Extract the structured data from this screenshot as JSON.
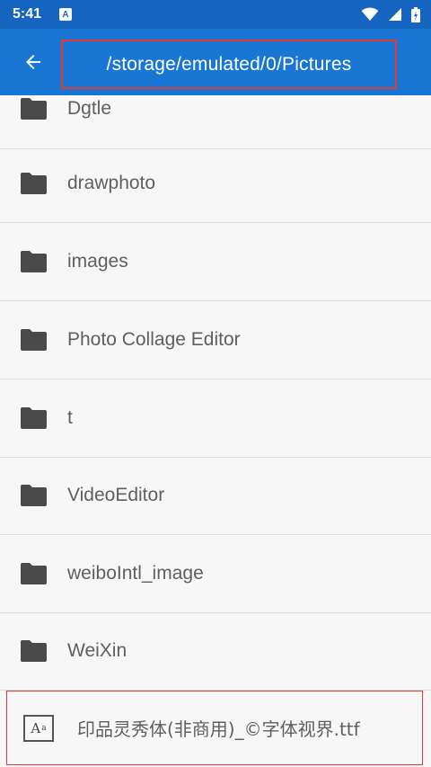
{
  "status_bar": {
    "time": "5:41",
    "notification_letter": "A",
    "icons": [
      "wifi-icon",
      "signal-icon",
      "battery-icon"
    ]
  },
  "app_bar": {
    "back_icon": "arrow-left-icon",
    "path": "/storage/emulated/0/Pictures"
  },
  "folders": [
    {
      "name": "Dgtle"
    },
    {
      "name": "drawphoto"
    },
    {
      "name": "images"
    },
    {
      "name": "Photo Collage Editor"
    },
    {
      "name": "t"
    },
    {
      "name": "VideoEditor"
    },
    {
      "name": "weiboIntl_image"
    },
    {
      "name": "WeiXin"
    }
  ],
  "file": {
    "name": "印品灵秀体(非商用)_©字体视界.ttf",
    "icon_text": "A",
    "icon_sup": "a"
  },
  "colors": {
    "status_bar": "#1565c0",
    "app_bar": "#1976d2",
    "highlight": "#e53935",
    "background": "#f7f7f7"
  }
}
